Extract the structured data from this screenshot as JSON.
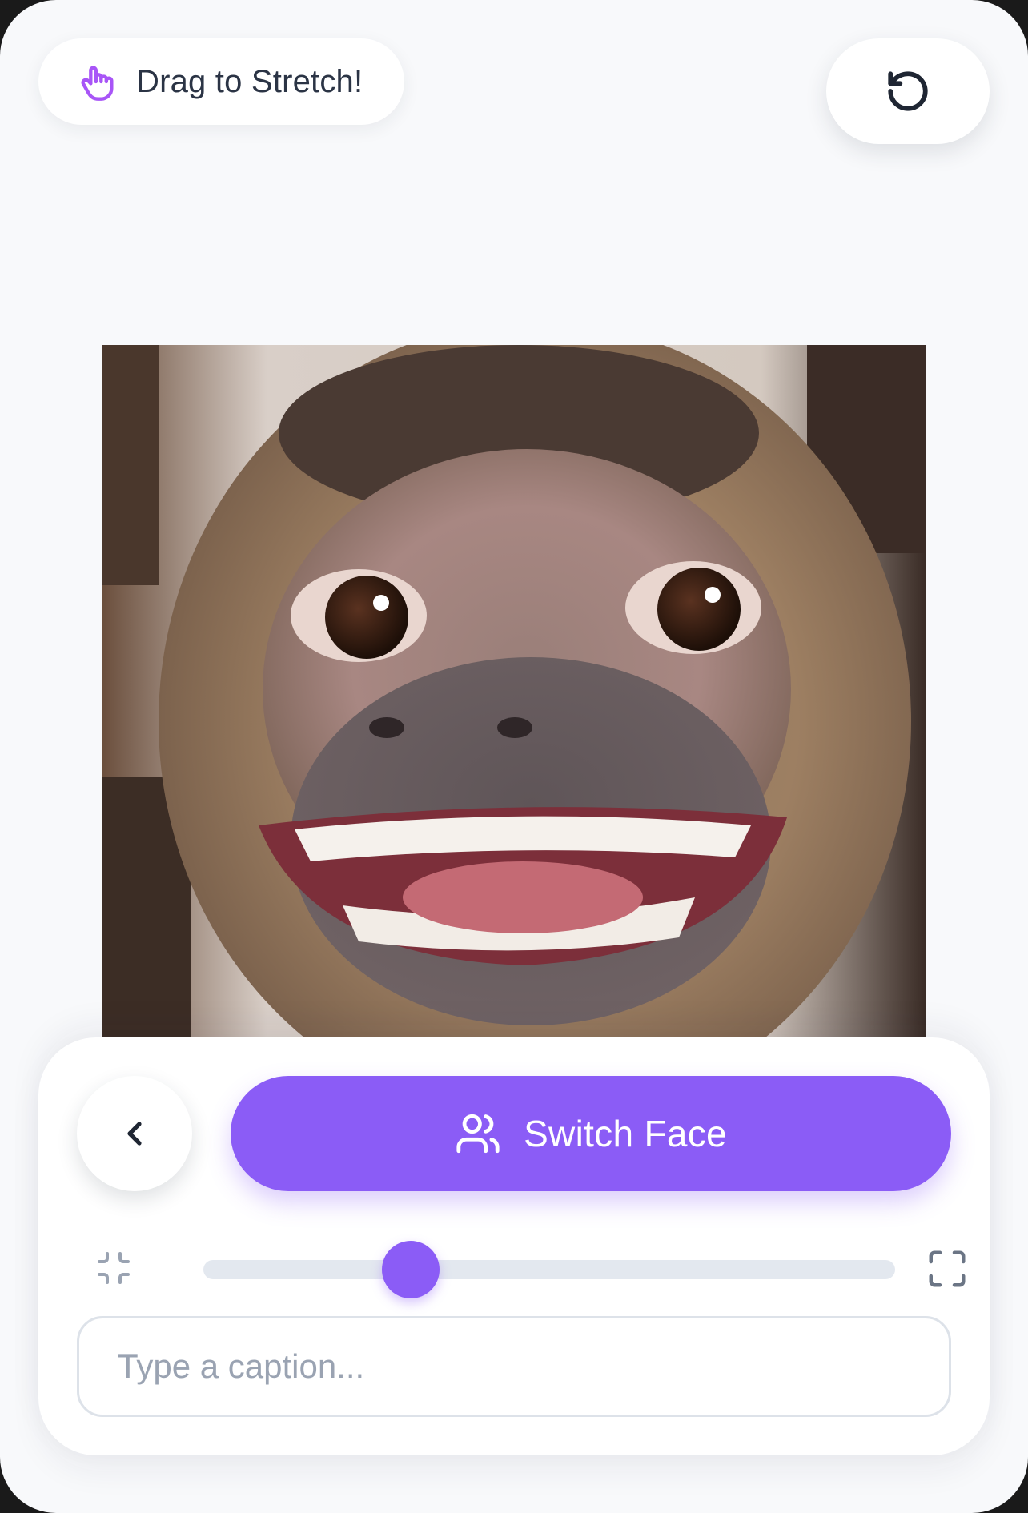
{
  "hint": {
    "icon": "hand-stop-icon",
    "text": "Drag to Stretch!"
  },
  "toolbar": {
    "reset_icon": "rotate-ccw-icon"
  },
  "photo": {
    "subject": "capuchin-monkey-face"
  },
  "controls": {
    "back_icon": "chevron-left-icon",
    "switch_face": {
      "icon": "users-icon",
      "label": "Switch Face"
    },
    "zoom": {
      "min_icon": "minimize-icon",
      "max_icon": "maximize-icon",
      "value_percent": 30
    },
    "caption": {
      "value": "",
      "placeholder": "Type a caption..."
    }
  },
  "colors": {
    "accent": "#8b5cf6",
    "background": "#f8f9fb",
    "track": "#e3e8ef",
    "text": "#2b3445",
    "placeholder": "#9aa3b2"
  }
}
